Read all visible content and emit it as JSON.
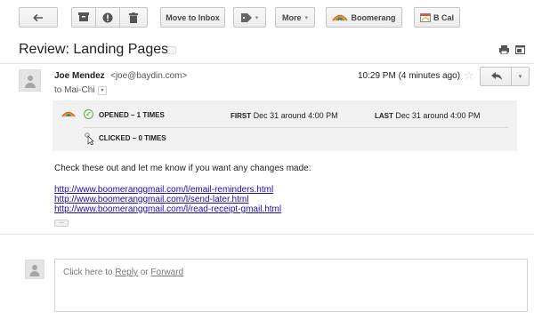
{
  "toolbar": {
    "move_to_inbox": "Move to Inbox",
    "more": "More",
    "boomerang": "Boomerang",
    "bcal": "B Cal",
    "caret": "▾"
  },
  "thread": {
    "subject": "Review: Landing Pages"
  },
  "message": {
    "sender_name": "Joe Mendez",
    "sender_email": "<joe@baydin.com>",
    "to": "to Mai-Chi",
    "time": "10:29 PM (4 minutes ago)",
    "star": "☆",
    "body": "Check these out and let me know if you want any changes made:",
    "links": [
      "http://www.boomeranggmail.com/l/email-reminders.html",
      "http://www.boomeranggmail.com/l/send-later.html",
      "http://www.boomeranggmail.com/l/read-receipt-gmail.html"
    ],
    "ellipsis": "..."
  },
  "tracking": {
    "opened": "OPENED – 1 TIMES",
    "first_label": "FIRST",
    "first_value": "Dec 31 around 4:00 PM",
    "last_label": "LAST",
    "last_value": "Dec 31 around 4:00 PM",
    "clicked": "CLICKED – 0 TIMES"
  },
  "reply": {
    "prefix": "Click here to",
    "reply_link": "Reply",
    "or": "or",
    "forward_link": "Forward"
  },
  "colors": {
    "link": "#1a0dab",
    "tracking_bg": "#f1f1f1",
    "check_green": "#3c8b2a"
  }
}
